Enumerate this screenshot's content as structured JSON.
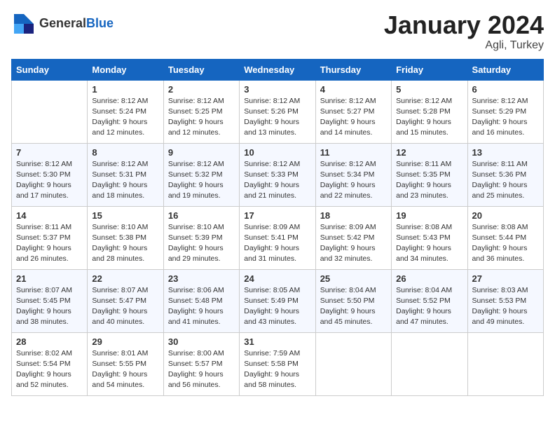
{
  "header": {
    "logo_general": "General",
    "logo_blue": "Blue",
    "month": "January 2024",
    "location": "Agli, Turkey"
  },
  "weekdays": [
    "Sunday",
    "Monday",
    "Tuesday",
    "Wednesday",
    "Thursday",
    "Friday",
    "Saturday"
  ],
  "weeks": [
    [
      {
        "day": "",
        "info": ""
      },
      {
        "day": "1",
        "info": "Sunrise: 8:12 AM\nSunset: 5:24 PM\nDaylight: 9 hours\nand 12 minutes."
      },
      {
        "day": "2",
        "info": "Sunrise: 8:12 AM\nSunset: 5:25 PM\nDaylight: 9 hours\nand 12 minutes."
      },
      {
        "day": "3",
        "info": "Sunrise: 8:12 AM\nSunset: 5:26 PM\nDaylight: 9 hours\nand 13 minutes."
      },
      {
        "day": "4",
        "info": "Sunrise: 8:12 AM\nSunset: 5:27 PM\nDaylight: 9 hours\nand 14 minutes."
      },
      {
        "day": "5",
        "info": "Sunrise: 8:12 AM\nSunset: 5:28 PM\nDaylight: 9 hours\nand 15 minutes."
      },
      {
        "day": "6",
        "info": "Sunrise: 8:12 AM\nSunset: 5:29 PM\nDaylight: 9 hours\nand 16 minutes."
      }
    ],
    [
      {
        "day": "7",
        "info": "Sunrise: 8:12 AM\nSunset: 5:30 PM\nDaylight: 9 hours\nand 17 minutes."
      },
      {
        "day": "8",
        "info": "Sunrise: 8:12 AM\nSunset: 5:31 PM\nDaylight: 9 hours\nand 18 minutes."
      },
      {
        "day": "9",
        "info": "Sunrise: 8:12 AM\nSunset: 5:32 PM\nDaylight: 9 hours\nand 19 minutes."
      },
      {
        "day": "10",
        "info": "Sunrise: 8:12 AM\nSunset: 5:33 PM\nDaylight: 9 hours\nand 21 minutes."
      },
      {
        "day": "11",
        "info": "Sunrise: 8:12 AM\nSunset: 5:34 PM\nDaylight: 9 hours\nand 22 minutes."
      },
      {
        "day": "12",
        "info": "Sunrise: 8:11 AM\nSunset: 5:35 PM\nDaylight: 9 hours\nand 23 minutes."
      },
      {
        "day": "13",
        "info": "Sunrise: 8:11 AM\nSunset: 5:36 PM\nDaylight: 9 hours\nand 25 minutes."
      }
    ],
    [
      {
        "day": "14",
        "info": "Sunrise: 8:11 AM\nSunset: 5:37 PM\nDaylight: 9 hours\nand 26 minutes."
      },
      {
        "day": "15",
        "info": "Sunrise: 8:10 AM\nSunset: 5:38 PM\nDaylight: 9 hours\nand 28 minutes."
      },
      {
        "day": "16",
        "info": "Sunrise: 8:10 AM\nSunset: 5:39 PM\nDaylight: 9 hours\nand 29 minutes."
      },
      {
        "day": "17",
        "info": "Sunrise: 8:09 AM\nSunset: 5:41 PM\nDaylight: 9 hours\nand 31 minutes."
      },
      {
        "day": "18",
        "info": "Sunrise: 8:09 AM\nSunset: 5:42 PM\nDaylight: 9 hours\nand 32 minutes."
      },
      {
        "day": "19",
        "info": "Sunrise: 8:08 AM\nSunset: 5:43 PM\nDaylight: 9 hours\nand 34 minutes."
      },
      {
        "day": "20",
        "info": "Sunrise: 8:08 AM\nSunset: 5:44 PM\nDaylight: 9 hours\nand 36 minutes."
      }
    ],
    [
      {
        "day": "21",
        "info": "Sunrise: 8:07 AM\nSunset: 5:45 PM\nDaylight: 9 hours\nand 38 minutes."
      },
      {
        "day": "22",
        "info": "Sunrise: 8:07 AM\nSunset: 5:47 PM\nDaylight: 9 hours\nand 40 minutes."
      },
      {
        "day": "23",
        "info": "Sunrise: 8:06 AM\nSunset: 5:48 PM\nDaylight: 9 hours\nand 41 minutes."
      },
      {
        "day": "24",
        "info": "Sunrise: 8:05 AM\nSunset: 5:49 PM\nDaylight: 9 hours\nand 43 minutes."
      },
      {
        "day": "25",
        "info": "Sunrise: 8:04 AM\nSunset: 5:50 PM\nDaylight: 9 hours\nand 45 minutes."
      },
      {
        "day": "26",
        "info": "Sunrise: 8:04 AM\nSunset: 5:52 PM\nDaylight: 9 hours\nand 47 minutes."
      },
      {
        "day": "27",
        "info": "Sunrise: 8:03 AM\nSunset: 5:53 PM\nDaylight: 9 hours\nand 49 minutes."
      }
    ],
    [
      {
        "day": "28",
        "info": "Sunrise: 8:02 AM\nSunset: 5:54 PM\nDaylight: 9 hours\nand 52 minutes."
      },
      {
        "day": "29",
        "info": "Sunrise: 8:01 AM\nSunset: 5:55 PM\nDaylight: 9 hours\nand 54 minutes."
      },
      {
        "day": "30",
        "info": "Sunrise: 8:00 AM\nSunset: 5:57 PM\nDaylight: 9 hours\nand 56 minutes."
      },
      {
        "day": "31",
        "info": "Sunrise: 7:59 AM\nSunset: 5:58 PM\nDaylight: 9 hours\nand 58 minutes."
      },
      {
        "day": "",
        "info": ""
      },
      {
        "day": "",
        "info": ""
      },
      {
        "day": "",
        "info": ""
      }
    ]
  ]
}
